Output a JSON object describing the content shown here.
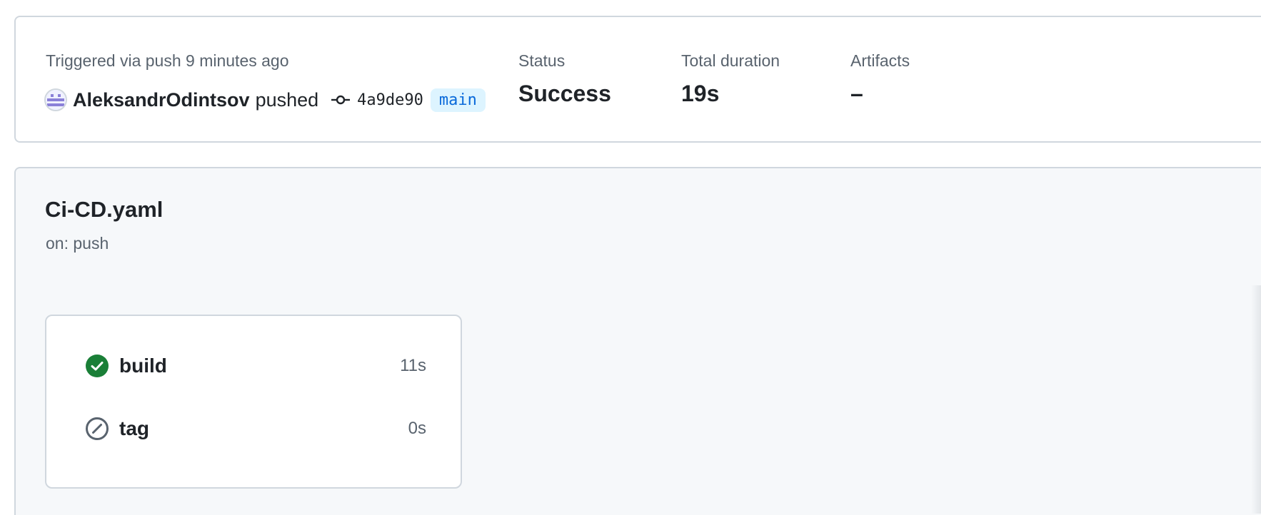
{
  "run": {
    "trigger_text": "Triggered via push 9 minutes ago",
    "actor": "AleksandrOdintsov",
    "action": "pushed",
    "commit_sha": "4a9de90",
    "branch": "main"
  },
  "stats": {
    "status_label": "Status",
    "status_value": "Success",
    "duration_label": "Total duration",
    "duration_value": "19s",
    "artifacts_label": "Artifacts",
    "artifacts_value": "–"
  },
  "workflow": {
    "file_name": "Ci-CD.yaml",
    "trigger": "on: push",
    "jobs": [
      {
        "name": "build",
        "duration": "11s",
        "status": "success",
        "icon": "check-circle-icon"
      },
      {
        "name": "tag",
        "duration": "0s",
        "status": "skipped",
        "icon": "skipped-icon"
      }
    ]
  },
  "colors": {
    "success": "#1a7f37",
    "skipped": "#59636e",
    "branch_bg": "#ddf4ff",
    "branch_fg": "#0969da",
    "panel_bg": "#f6f8fa"
  }
}
